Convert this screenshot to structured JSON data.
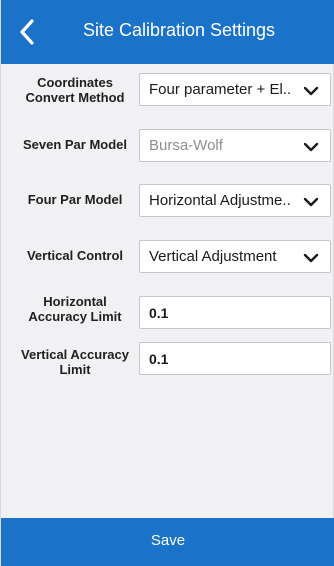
{
  "header": {
    "title": "Site Calibration Settings",
    "back_icon": "chevron-left-icon"
  },
  "form": {
    "coordinates_convert": {
      "label": "Coordinates Convert Method",
      "value": "Four parameter + El..",
      "disabled": false
    },
    "seven_par_model": {
      "label": "Seven Par Model",
      "value": "Bursa-Wolf",
      "disabled": true
    },
    "four_par_model": {
      "label": "Four Par Model",
      "value": "Horizontal Adjustme..",
      "disabled": false
    },
    "vertical_control": {
      "label": "Vertical Control",
      "value": "Vertical Adjustment",
      "disabled": false
    },
    "horizontal_accuracy": {
      "label": "Horizontal Accuracy Limit",
      "value": "0.1"
    },
    "vertical_accuracy": {
      "label": "Vertical Accuracy Limit",
      "value": "0.1"
    }
  },
  "footer": {
    "save_label": "Save"
  },
  "colors": {
    "primary": "#1a72c9",
    "background": "#f1f1f3",
    "disabled_text": "#8e8e8e"
  }
}
